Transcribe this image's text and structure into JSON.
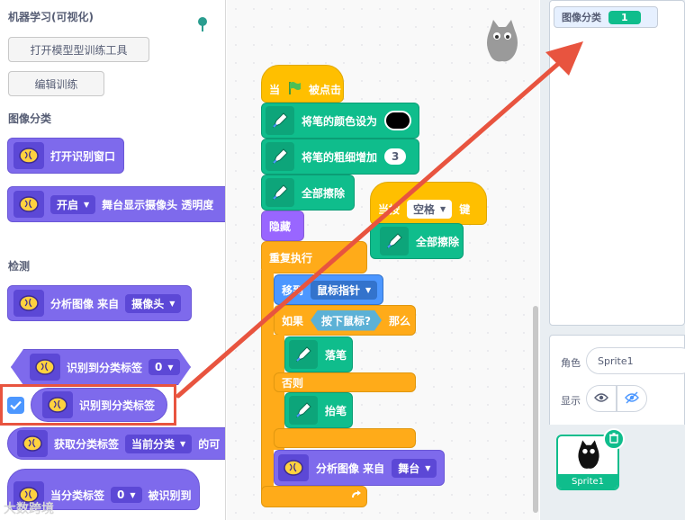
{
  "palette": {
    "ml_title": "机器学习(可视化)",
    "open_trainer": "打开模型型训练工具",
    "edit_training": "编辑训练",
    "image_section": "图像分类",
    "open_window": "打开识别窗口",
    "camera_block": {
      "option": "开启",
      "text": "舞台显示摄像头 透明度"
    },
    "detect_section": "检测",
    "analyze_block": {
      "text": "分析图像 来自",
      "option": "摄像头"
    },
    "recognized_label_block": {
      "text": "识别到分类标签",
      "option": "0"
    },
    "reporter_block": {
      "text": "识别到分类标签"
    },
    "get_label_block": {
      "text": "获取分类标签",
      "option": "当前分类",
      "suffix": "的可"
    },
    "hat_block": {
      "text": "当分类标签",
      "option": "0",
      "suffix": "被识别到"
    }
  },
  "script": {
    "when_flag": {
      "pre": "当",
      "post": "被点击"
    },
    "set_pen_color": "将笔的颜色设为",
    "change_pen_size": {
      "text": "将笔的粗细增加",
      "value": "3"
    },
    "clear_all_1": "全部擦除",
    "hide": "隐藏",
    "forever": "重复执行",
    "goto": {
      "text": "移到",
      "option": "鼠标指针"
    },
    "if_block": {
      "pre": "如果",
      "condition": "按下鼠标?",
      "post": "那么"
    },
    "pen_down": "落笔",
    "else": "否则",
    "pen_up": "抬笔",
    "analyze": {
      "text": "分析图像 来自",
      "option": "舞台"
    },
    "when_key": {
      "pre": "当按",
      "option": "空格",
      "post": "键"
    },
    "clear_all_2": "全部擦除"
  },
  "stage": {
    "monitor_label": "图像分类",
    "monitor_value": "1"
  },
  "sprite_panel": {
    "role_label": "角色",
    "sprite_name": "Sprite1",
    "show_label": "显示",
    "card_name": "Sprite1"
  },
  "watermark": "大数跨境",
  "colors": {
    "ml": "#7e6aec",
    "pen": "#0fbd8c",
    "event": "#ffbf00",
    "control": "#ffab19",
    "motion": "#4c97ff",
    "looks": "#9966ff",
    "arrow": "#e8543f"
  }
}
